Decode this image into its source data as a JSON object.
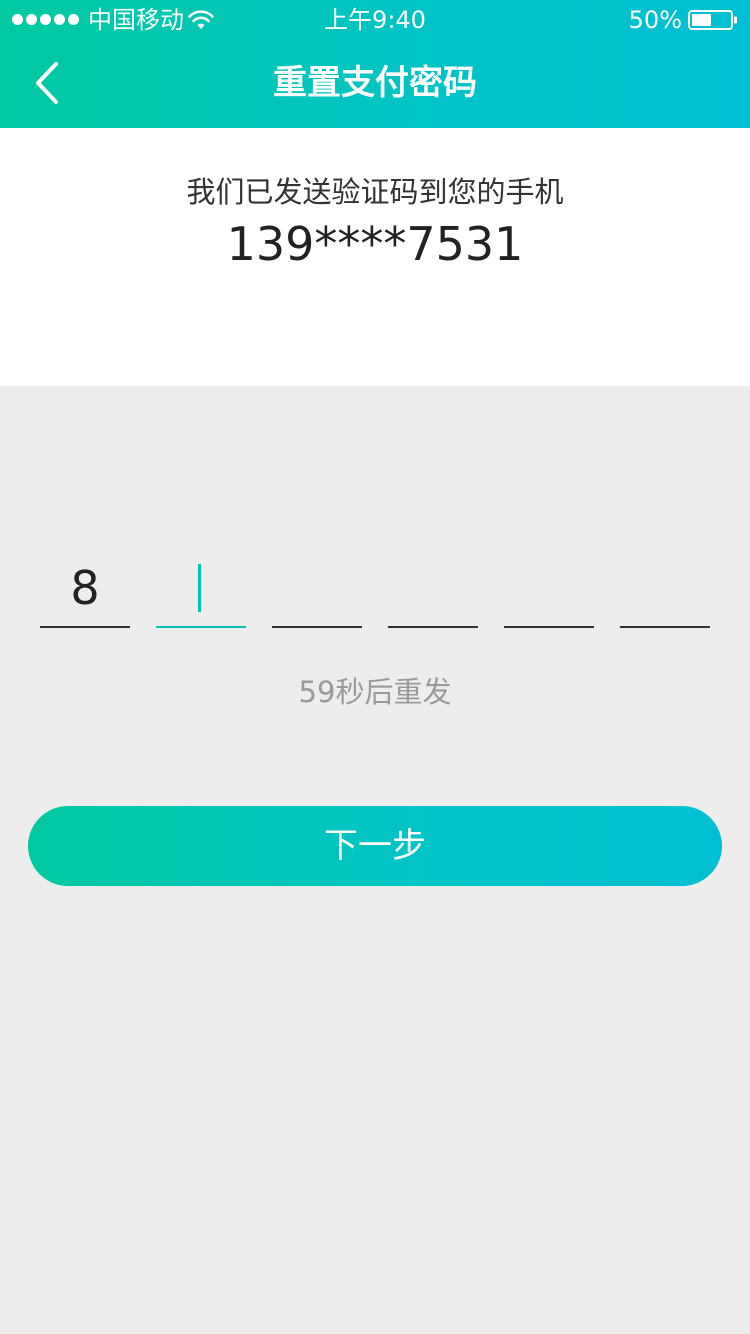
{
  "status_bar": {
    "carrier": "中国移动",
    "time": "上午9:40",
    "battery_percent": "50%",
    "battery_level": 0.5,
    "signal_strength": 5
  },
  "nav": {
    "title": "重置支付密码",
    "back_icon": "chevron-left-icon"
  },
  "info": {
    "message": "我们已发送验证码到您的手机",
    "phone": "139****7531"
  },
  "code": {
    "digits": [
      "8",
      "",
      "",
      "",
      "",
      ""
    ],
    "active_index": 1
  },
  "resend": {
    "label": "59秒后重发"
  },
  "actions": {
    "next_label": "下一步"
  },
  "colors": {
    "accent_start": "#00c9a1",
    "accent_end": "#00bfd3",
    "background": "#ededed"
  }
}
